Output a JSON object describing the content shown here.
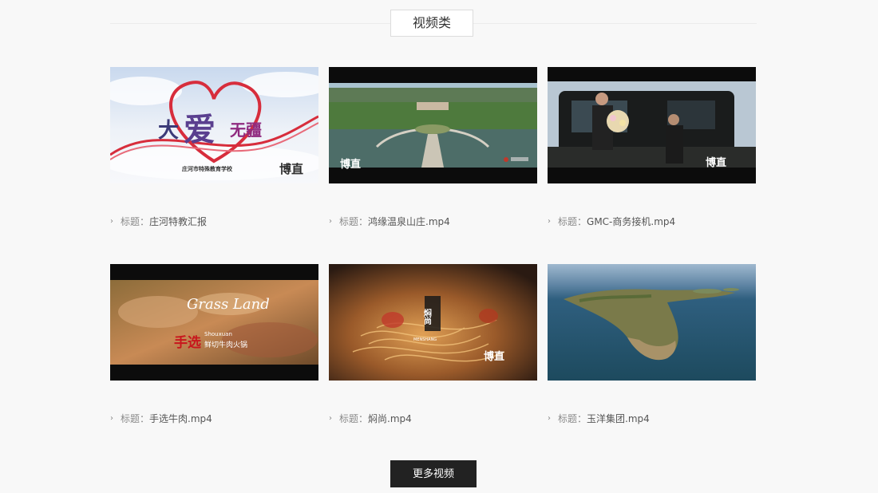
{
  "section": {
    "title": "视频类"
  },
  "caption_label": "标题：",
  "videos": [
    {
      "title": "庄河特教汇报",
      "thumb": {
        "main_text_1": "大",
        "main_text_2": "爱",
        "main_text_3": "无疆",
        "sub_text": "庄河市特殊教育学校",
        "logo": "博直"
      }
    },
    {
      "title": "鸿缘温泉山庄.mp4",
      "thumb": {
        "logo": "博直"
      }
    },
    {
      "title": "GMC-商务接机.mp4",
      "thumb": {
        "logo": "博直"
      }
    },
    {
      "title": "手选牛肉.mp4",
      "thumb": {
        "brand": "Grass Land",
        "cn_text_1": "手选",
        "cn_text_2": "鲜切牛肉火锅",
        "pinyin": "Shouxuan"
      }
    },
    {
      "title": "焖尚.mp4",
      "thumb": {
        "brand": "焖尚",
        "brand_en": "MENSHANG",
        "logo": "博直"
      }
    },
    {
      "title": "玉洋集团.mp4",
      "thumb": {}
    }
  ],
  "more_button": {
    "label": "更多视频"
  },
  "colors": {
    "page_bg": "#f8f8f8",
    "button_bg": "#222222",
    "caption_text": "#555555"
  }
}
